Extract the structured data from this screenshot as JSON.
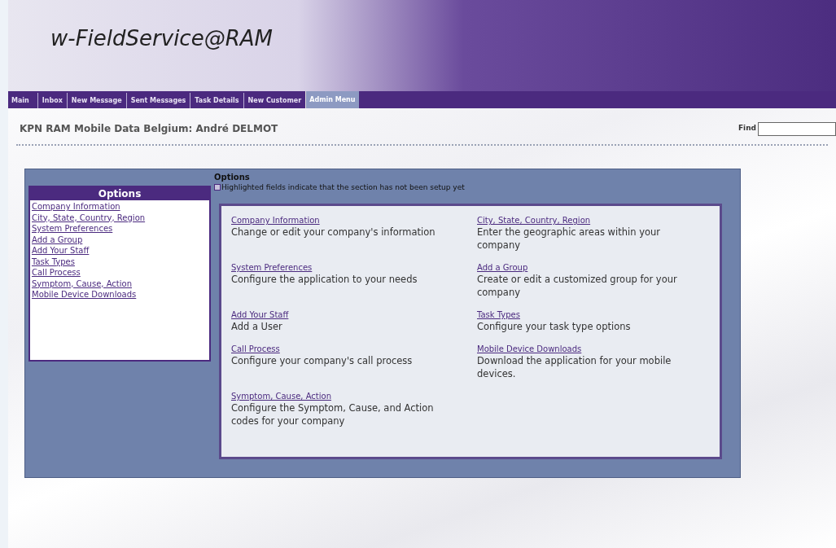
{
  "app_title": "w-FieldService@RAM",
  "tabs": [
    {
      "label": "Main",
      "selected": false
    },
    {
      "label": "Inbox",
      "selected": false
    },
    {
      "label": "New Message",
      "selected": false
    },
    {
      "label": "Sent Messages",
      "selected": false
    },
    {
      "label": "Task Details",
      "selected": false
    },
    {
      "label": "New Customer",
      "selected": false
    },
    {
      "label": "Admin Menu",
      "selected": true
    }
  ],
  "page_heading": "KPN RAM Mobile Data Belgium: André DELMOT",
  "find": {
    "label": "Find"
  },
  "sidebar": {
    "title": "Options",
    "items": [
      "Company Information",
      "City, State, Country, Region",
      "System Preferences",
      "Add a Group",
      "Add Your Staff",
      "Task Types",
      "Call Process",
      "Symptom, Cause, Action",
      "Mobile Device Downloads"
    ]
  },
  "options": {
    "title": "Options",
    "legend": "Highlighted fields indicate that the section has not been setup yet",
    "sections": [
      {
        "link": "Company Information",
        "description": "Change or edit your company's information"
      },
      {
        "link": "City, State, Country, Region",
        "description": "Enter the geographic areas within your company"
      },
      {
        "link": "System Preferences",
        "description": "Configure the application to your needs"
      },
      {
        "link": "Add a Group",
        "description": "Create or edit a customized group for your company"
      },
      {
        "link": "Add Your Staff",
        "description": "Add a User"
      },
      {
        "link": "Task Types",
        "description": "Configure your task type options"
      },
      {
        "link": "Call Process",
        "description": "Configure your company's call process"
      },
      {
        "link": "Mobile Device Downloads",
        "description": "Download the application for your mobile devices."
      },
      {
        "link": "Symptom, Cause, Action",
        "description": "Configure the Symptom, Cause, and Action codes for your company"
      }
    ]
  }
}
